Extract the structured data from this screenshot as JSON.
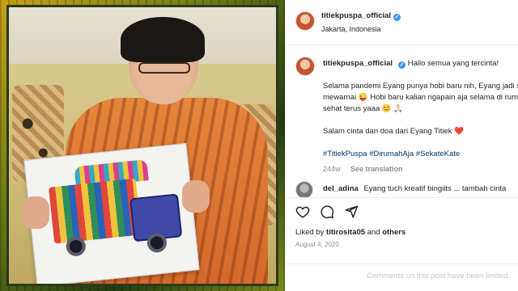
{
  "header": {
    "username": "titiekpuspa_official",
    "location": "Jakarta, Indonesia",
    "verified": true
  },
  "caption": {
    "username": "titiekpuspa_official",
    "line1": "Hallo semua yang tercinta!",
    "line2": "Selama pandemi Eyang punya hobi baru nih, Eyang jadi suka",
    "line3": "mewarnai 😜 Hobi baru kalian ngapain aja selama di rumah? Jaga",
    "line4": "sehat terus yaaa 😊 🙏🏻",
    "line5": "Salam cinta dan doa dari Eyang Titiek ❤️",
    "hashtags": [
      "#TitiekPuspa",
      "#DirumahAja",
      "#SekateKate"
    ],
    "age": "244w",
    "translate_label": "See translation"
  },
  "comment": {
    "username": "del_adina",
    "text": "Eyang tuch kreatif bingiits ... tambah cinta"
  },
  "actions": {
    "like_icon": "heart-outline-icon",
    "comment_icon": "comment-bubble-icon",
    "share_icon": "paper-plane-icon"
  },
  "likes": {
    "prefix": "Liked by",
    "user": "titirosita05",
    "joiner": "and",
    "others": "others"
  },
  "post_date": "August 4, 2020",
  "limited_notice": "Comments on this post have been limited.",
  "colors": {
    "link": "#00376b",
    "verified": "#3897f0",
    "muted": "#8e8e8e"
  }
}
